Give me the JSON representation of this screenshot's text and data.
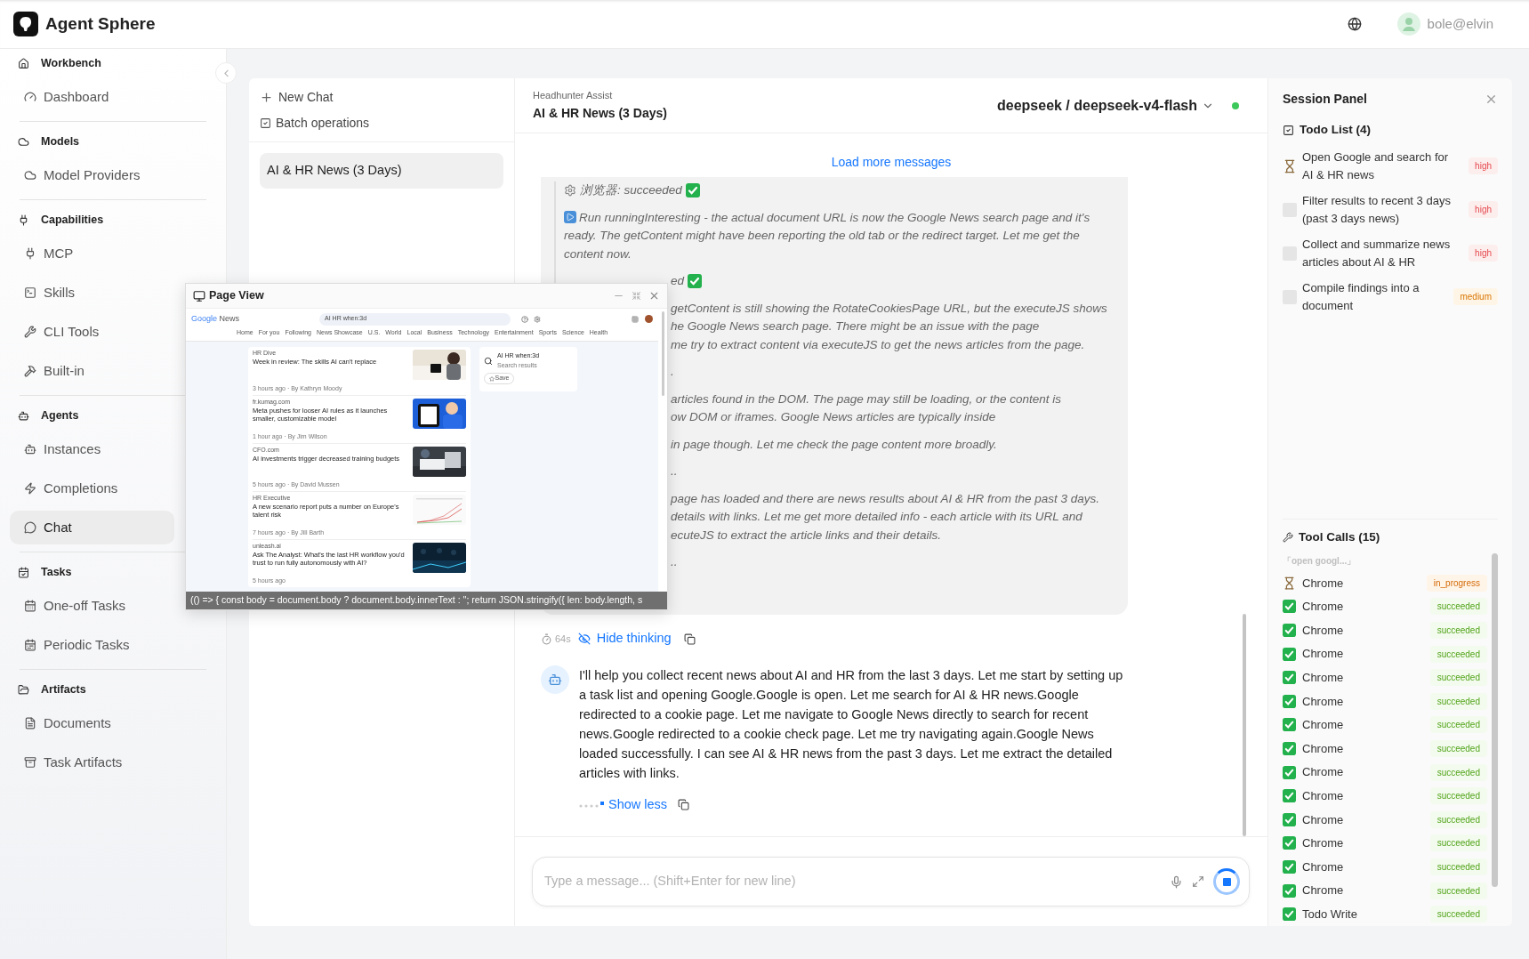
{
  "app": {
    "name": "Agent Sphere"
  },
  "header": {
    "user": "bole@elvin"
  },
  "sidebar": {
    "sections": [
      {
        "title": "Workbench",
        "items": [
          {
            "label": "Dashboard",
            "selected": false
          }
        ]
      },
      {
        "title": "Models",
        "items": [
          {
            "label": "Model Providers",
            "selected": false
          }
        ]
      },
      {
        "title": "Capabilities",
        "items": [
          {
            "label": "MCP",
            "selected": false
          },
          {
            "label": "Skills",
            "selected": false
          },
          {
            "label": "CLI Tools",
            "selected": false
          },
          {
            "label": "Built-in",
            "selected": false
          }
        ]
      },
      {
        "title": "Agents",
        "items": [
          {
            "label": "Instances",
            "selected": false
          },
          {
            "label": "Completions",
            "selected": false
          },
          {
            "label": "Chat",
            "selected": true
          }
        ]
      },
      {
        "title": "Tasks",
        "items": [
          {
            "label": "One-off Tasks",
            "selected": false
          },
          {
            "label": "Periodic Tasks",
            "selected": false
          }
        ]
      },
      {
        "title": "Artifacts",
        "items": [
          {
            "label": "Documents",
            "selected": false
          },
          {
            "label": "Task Artifacts",
            "selected": false
          }
        ]
      }
    ]
  },
  "chat_list": {
    "new_chat": "New Chat",
    "batch": "Batch operations",
    "chats": [
      {
        "title": "AI & HR News (3 Days)",
        "selected": true
      }
    ]
  },
  "chat": {
    "agent": "Headhunter Assist",
    "title": "AI & HR News (3 Days)",
    "model": "deepseek / deepseek-v4-flash",
    "online": true,
    "load_more": "Load more messages",
    "thinking": [
      {
        "kind": "step",
        "lines": [
          "浏览器: succeeded"
        ]
      },
      {
        "kind": "run",
        "lines": [
          "Run runningInteresting - the actual document URL is now the Google News search page and it's ready. The getContent might have been reporting the old tab or the redirect target. Let me get the content now."
        ]
      },
      {
        "kind": "step",
        "covered": true,
        "lines": [
          "ed"
        ]
      },
      {
        "kind": "text",
        "covered": true,
        "lines": [
          "getContent is still showing the RotateCookiesPage URL, but the executeJS shows",
          "he Google News search page. There might be an issue with the page",
          "me try to extract content via executeJS to get the news articles from the page."
        ]
      },
      {
        "kind": "text",
        "covered": true,
        "lines": [
          "."
        ]
      },
      {
        "kind": "text",
        "covered": true,
        "lines": [
          "articles found in the DOM. The page may still be loading, or the content is",
          "ow DOM or iframes. Google News articles are typically inside"
        ]
      },
      {
        "kind": "text",
        "covered": true,
        "lines": [
          "in page though. Let me check the page content more broadly."
        ]
      },
      {
        "kind": "text",
        "covered": true,
        "lines": [
          ".."
        ]
      },
      {
        "kind": "text",
        "covered": true,
        "lines": [
          "page has loaded and there are news results about AI & HR from the past 3 days.",
          "details with links. Let me get more detailed info - each article with its URL and",
          "ecuteJS to extract the article links and their details."
        ]
      },
      {
        "kind": "text",
        "covered": true,
        "lines": [
          ".."
        ]
      }
    ],
    "duration": "64s",
    "hide_thinking": "Hide thinking",
    "message": "I'll help you collect recent news about AI and HR from the last 3 days. Let me start by setting up a task list and opening Google.Google is open. Let me search for AI & HR news.Google redirected to a cookie page. Let me navigate to Google News directly to search for recent news.Google redirected to a cookie check page. Let me try navigating again.Google News loaded successfully. I can see AI & HR news from the past 3 days. Let me extract the detailed articles with links.",
    "show_less": "Show less",
    "input_placeholder": "Type a message... (Shift+Enter for new line)",
    "generating": true
  },
  "page_view": {
    "title": "Page View",
    "site": {
      "logo": "Google",
      "name": "News",
      "query": "AI HR when:3d",
      "nav": [
        "Home",
        "For you",
        "Following",
        "News Showcase",
        "U.S.",
        "World",
        "Local",
        "Business",
        "Technology",
        "Entertainment",
        "Sports",
        "Science",
        "Health"
      ],
      "articles": [
        {
          "source": "HR Dive",
          "title": "Week in review: The skills AI can't replace",
          "meta": "3 hours ago · By Kathryn Moody"
        },
        {
          "source": "fr.kumag.com",
          "title": "Meta pushes for looser AI rules as it launches smaller, customizable model",
          "meta": "1 hour ago · By Jim Wilson"
        },
        {
          "source": "CFO.com",
          "title": "AI investments trigger decreased training budgets",
          "meta": "5 hours ago · By David Mussen"
        },
        {
          "source": "HR Executive",
          "title": "A new scenario report puts a number on Europe's talent risk",
          "meta": "7 hours ago · By Jill Barth"
        },
        {
          "source": "unleash.ai",
          "title": "Ask The Analyst: What's the last HR workflow you'd trust to run fully autonomously with AI?",
          "meta": "5 hours ago"
        }
      ],
      "card": {
        "title": "AI HR when:3d",
        "subtitle": "Search results",
        "save": "Save"
      }
    },
    "command": "(() => { const body = document.body ? document.body.innerText : ''; return JSON.stringify({ len: body.length, s"
  },
  "session_panel": {
    "title": "Session Panel",
    "todo_title": "Todo List (4)",
    "todos": [
      {
        "text": "Open Google and search for AI & HR news",
        "kind": "in_progress",
        "priority": "high",
        "urgent": true
      },
      {
        "text": "Filter results to recent 3 days (past 3 days news)",
        "kind": "pending",
        "priority": "high",
        "urgent": true
      },
      {
        "text": "Collect and summarize news articles about AI & HR",
        "kind": "pending",
        "priority": "high",
        "urgent": true
      },
      {
        "text": "Compile findings into a document",
        "kind": "pending",
        "priority": "medium",
        "urgent": false
      }
    ],
    "tools_title": "Tool Calls (15)",
    "tools_query": "「open googl...」",
    "tools": [
      {
        "name": "Chrome",
        "kind": "running",
        "status": "in_progress"
      },
      {
        "name": "Chrome",
        "kind": "done",
        "status": "succeeded"
      },
      {
        "name": "Chrome",
        "kind": "done",
        "status": "succeeded"
      },
      {
        "name": "Chrome",
        "kind": "done",
        "status": "succeeded"
      },
      {
        "name": "Chrome",
        "kind": "done",
        "status": "succeeded"
      },
      {
        "name": "Chrome",
        "kind": "done",
        "status": "succeeded"
      },
      {
        "name": "Chrome",
        "kind": "done",
        "status": "succeeded"
      },
      {
        "name": "Chrome",
        "kind": "done",
        "status": "succeeded"
      },
      {
        "name": "Chrome",
        "kind": "done",
        "status": "succeeded"
      },
      {
        "name": "Chrome",
        "kind": "done",
        "status": "succeeded"
      },
      {
        "name": "Chrome",
        "kind": "done",
        "status": "succeeded"
      },
      {
        "name": "Chrome",
        "kind": "done",
        "status": "succeeded"
      },
      {
        "name": "Chrome",
        "kind": "done",
        "status": "succeeded"
      },
      {
        "name": "Chrome",
        "kind": "done",
        "status": "succeeded"
      },
      {
        "name": "Todo Write",
        "kind": "done",
        "status": "succeeded"
      }
    ]
  }
}
